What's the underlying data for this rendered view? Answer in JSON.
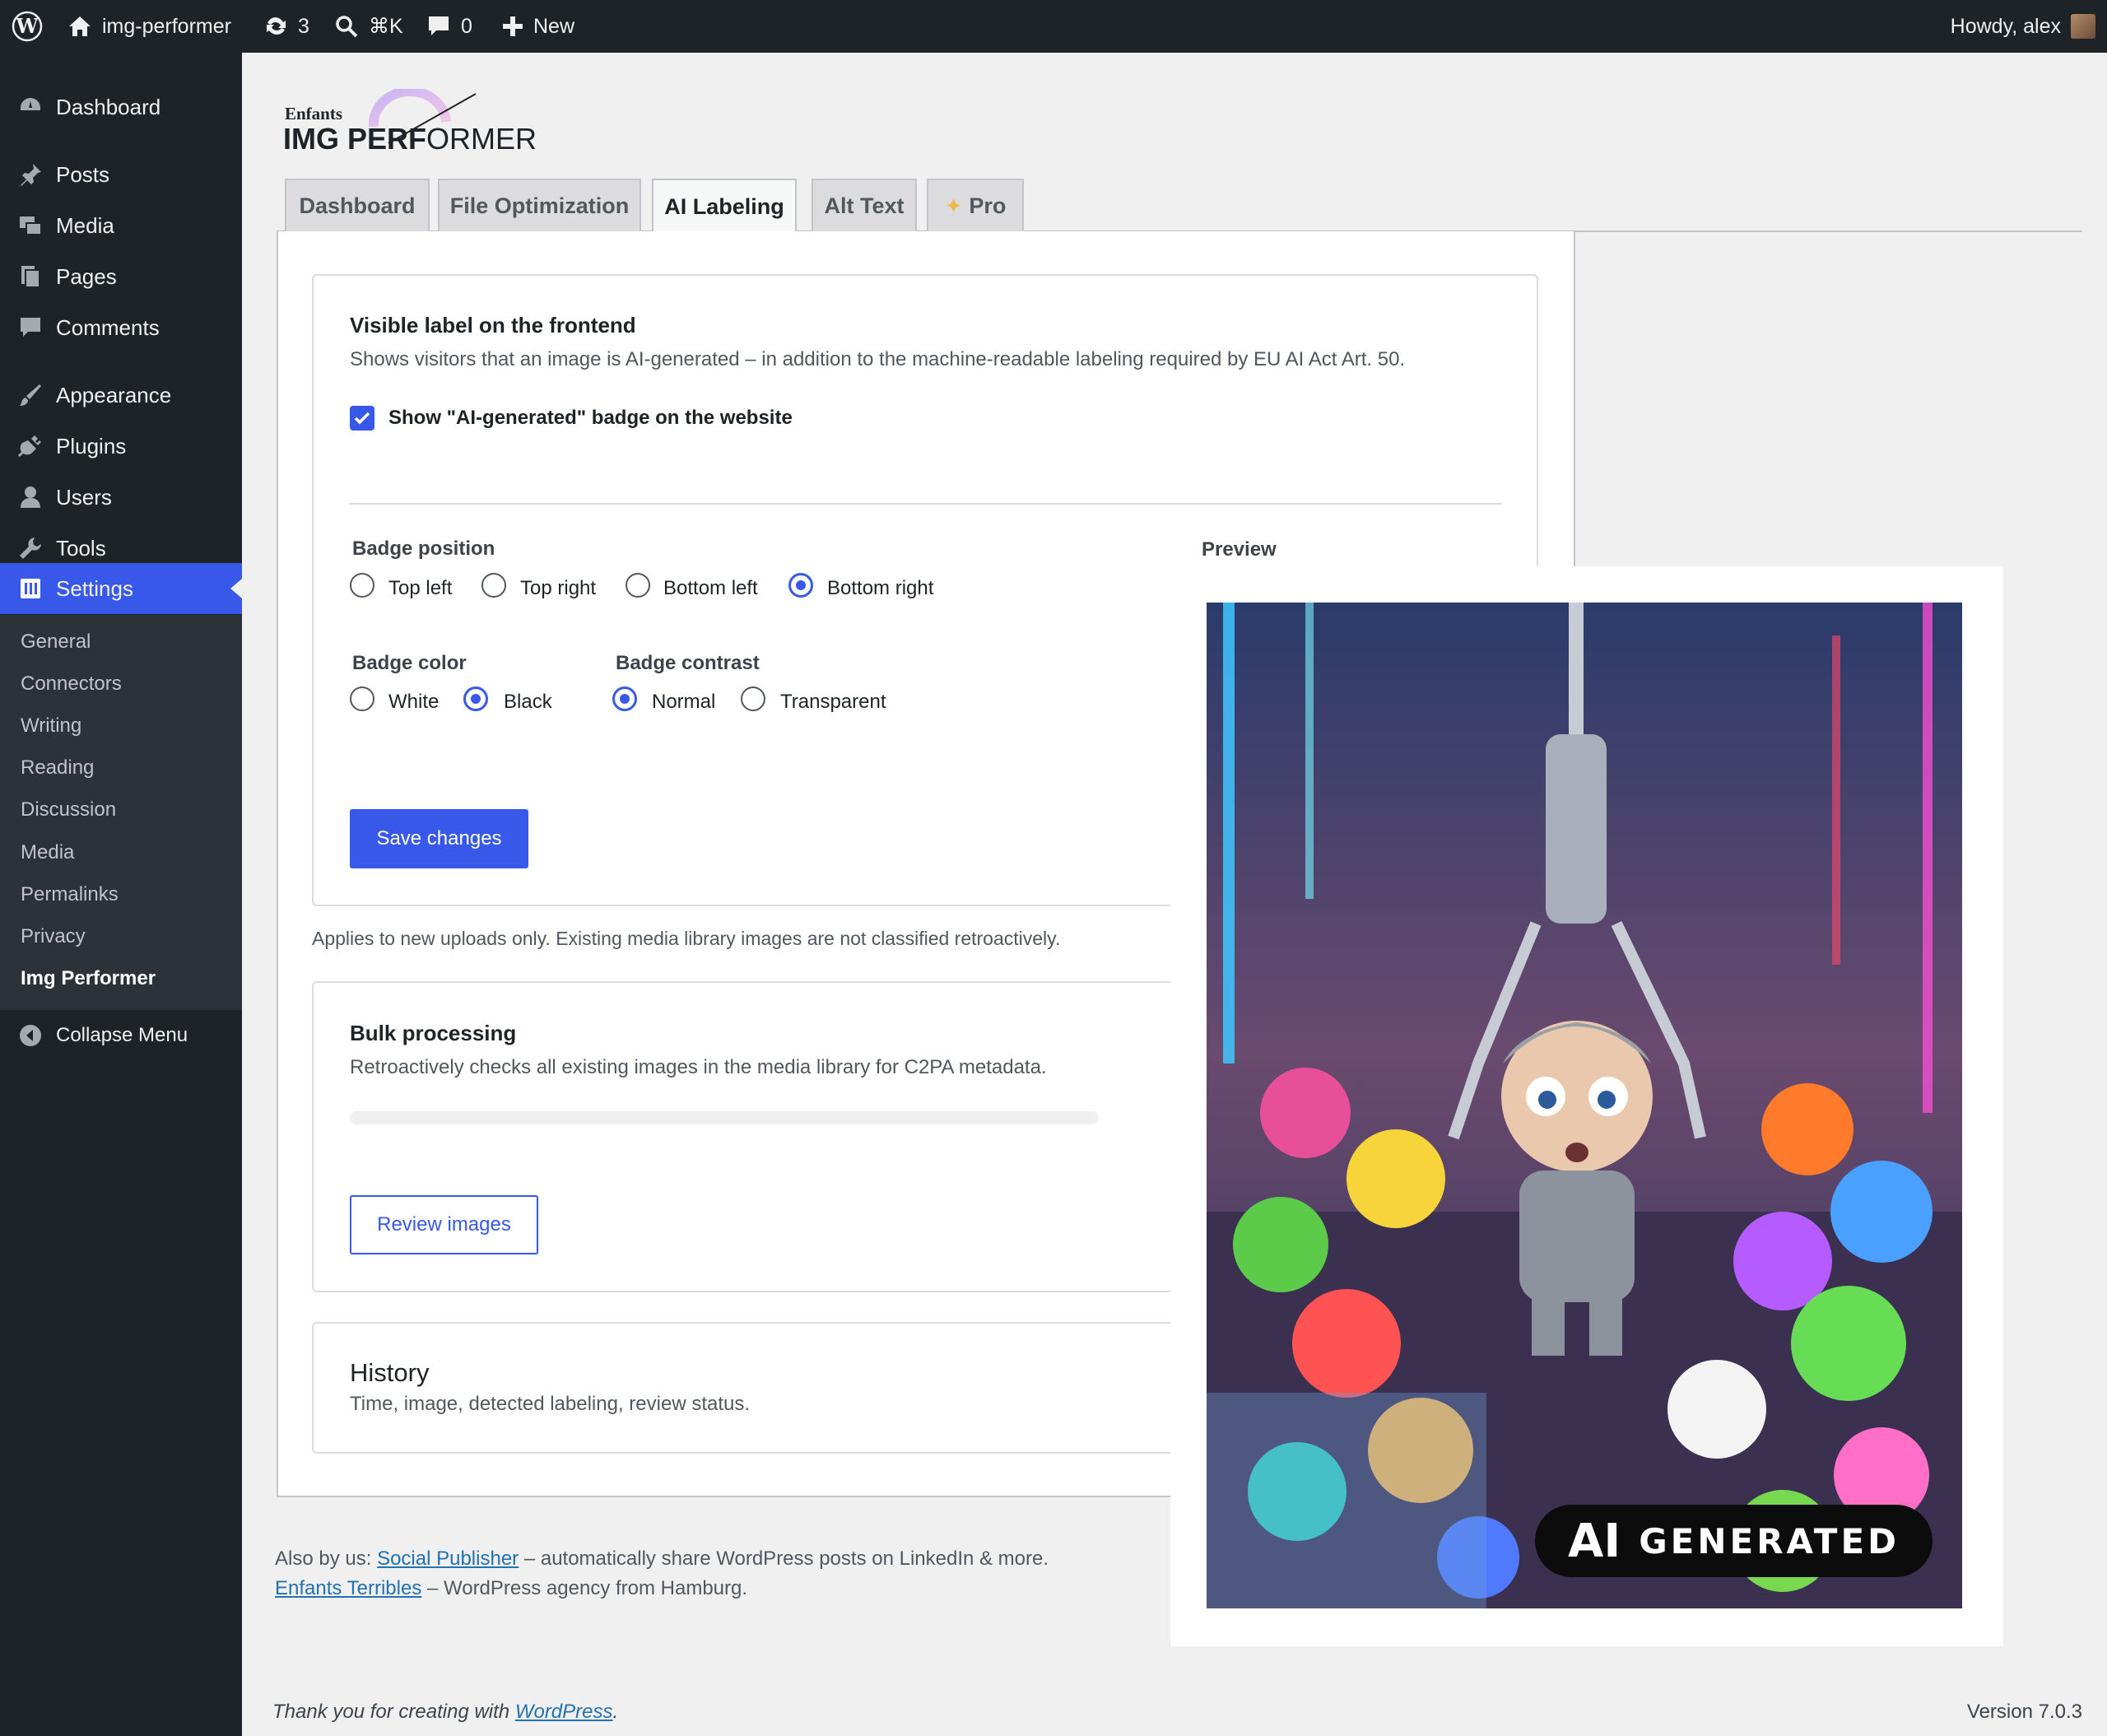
{
  "adminbar": {
    "site_name": "img-performer",
    "updates_count": "3",
    "search_shortcut": "⌘K",
    "comments_count": "0",
    "new_label": "New",
    "greeting": "Howdy, alex"
  },
  "sidebar": {
    "items": [
      {
        "label": "Dashboard",
        "icon": "dashboard-icon"
      },
      {
        "label": "Posts",
        "icon": "pin-icon"
      },
      {
        "label": "Media",
        "icon": "media-icon"
      },
      {
        "label": "Pages",
        "icon": "pages-icon"
      },
      {
        "label": "Comments",
        "icon": "comment-icon"
      },
      {
        "label": "Appearance",
        "icon": "brush-icon"
      },
      {
        "label": "Plugins",
        "icon": "plugin-icon"
      },
      {
        "label": "Users",
        "icon": "user-icon"
      },
      {
        "label": "Tools",
        "icon": "wrench-icon"
      },
      {
        "label": "Settings",
        "icon": "settings-icon"
      }
    ],
    "submenu": [
      "General",
      "Connectors",
      "Writing",
      "Reading",
      "Discussion",
      "Media",
      "Permalinks",
      "Privacy",
      "Img Performer"
    ],
    "collapse_label": "Collapse Menu"
  },
  "logo": {
    "small": "Enfants",
    "main_bold": "IMG PERF",
    "main_light": "ORMER"
  },
  "tabs": [
    "Dashboard",
    "File Optimization",
    "AI Labeling",
    "Alt Text",
    "Pro"
  ],
  "visible_label": {
    "heading": "Visible label on the frontend",
    "description": "Shows visitors that an image is AI-generated – in addition to the machine-readable labeling required by EU AI Act Art. 50.",
    "checkbox_label": "Show \"AI-generated\" badge on the website",
    "checkbox_checked": true
  },
  "badge_position": {
    "label": "Badge position",
    "options": [
      "Top left",
      "Top right",
      "Bottom left",
      "Bottom right"
    ],
    "selected": "Bottom right"
  },
  "badge_color": {
    "label": "Badge color",
    "options": [
      "White",
      "Black"
    ],
    "selected": "Black"
  },
  "badge_contrast": {
    "label": "Badge contrast",
    "options": [
      "Normal",
      "Transparent"
    ],
    "selected": "Normal"
  },
  "preview": {
    "label": "Preview",
    "badge_ai": "AI",
    "badge_text": "GENERATED"
  },
  "save_button": "Save changes",
  "uploads_note": "Applies to new uploads only. Existing media library images are not classified retroactively.",
  "bulk": {
    "heading": "Bulk processing",
    "description": "Retroactively checks all existing images in the media library for C2PA metadata.",
    "progress": 0,
    "button": "Review images"
  },
  "history": {
    "heading": "History",
    "description": "Time, image, detected labeling, review status."
  },
  "footer": {
    "also_by": "Also by us:",
    "social_publisher": "Social Publisher",
    "social_publisher_desc": "– automatically share WordPress posts on LinkedIn & more.",
    "enfants_terribles": "Enfants Terribles",
    "enfants_desc": "– WordPress agency from Hamburg.",
    "thanks_prefix": "Thank you for creating with",
    "wordpress": "WordPress",
    "version": "Version 7.0.3"
  },
  "colors": {
    "accent": "#3858e9",
    "adminbar": "#1d2327",
    "background": "#f0f0f1"
  }
}
